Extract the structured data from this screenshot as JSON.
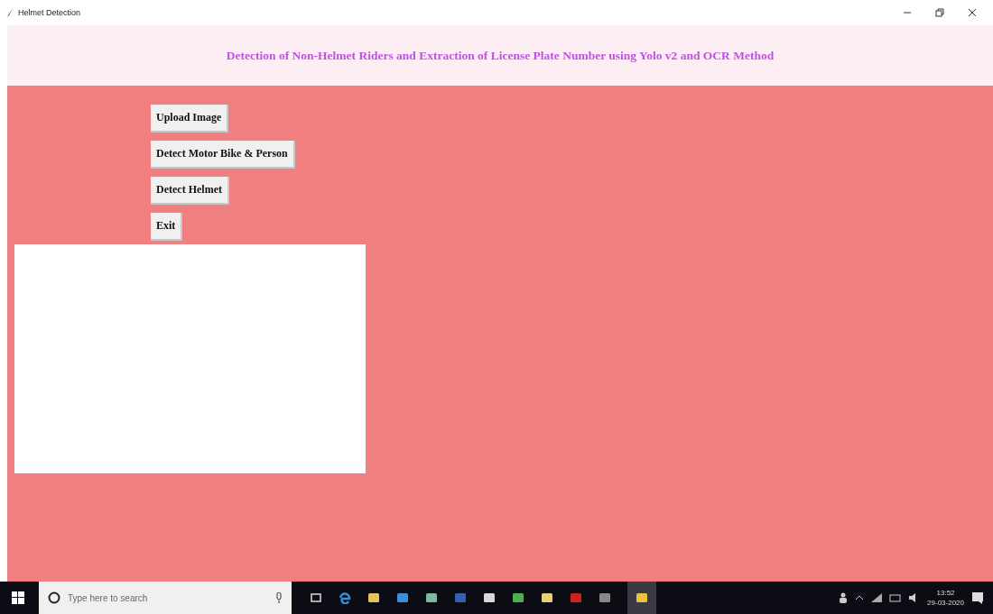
{
  "window": {
    "title": "Helmet Detection"
  },
  "header": {
    "title": "Detection of Non-Helmet Riders and Extraction of License Plate Number using Yolo v2 and OCR Method"
  },
  "buttons": [
    {
      "label": "Upload Image"
    },
    {
      "label": "Detect Motor Bike & Person"
    },
    {
      "label": "Detect Helmet"
    },
    {
      "label": "Exit"
    }
  ],
  "taskbar": {
    "search": {
      "placeholder": "Type here to search"
    },
    "time": "13:52",
    "date": "29-03-2020"
  }
}
